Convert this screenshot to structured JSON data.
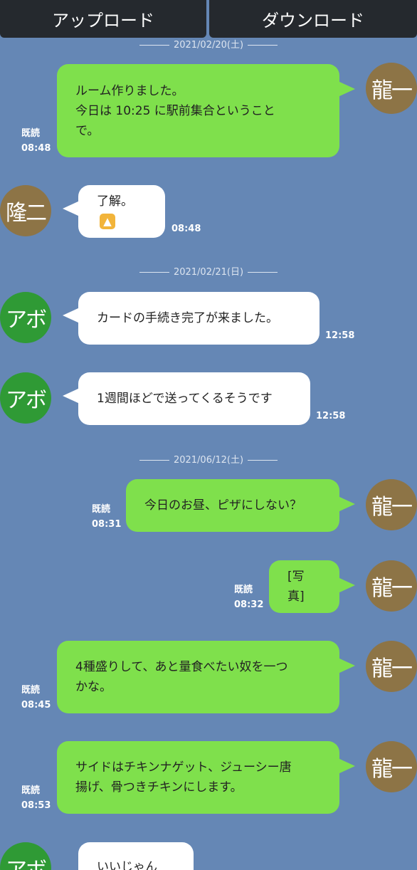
{
  "tabs": {
    "upload": "アップロード",
    "download": "ダウンロード"
  },
  "dates": [
    "2021/02/20(土)",
    "2021/02/21(日)",
    "2021/06/12(土)"
  ],
  "read_label": "既読",
  "avatars": {
    "ryuichi": "龍一",
    "ryuji": "隆二",
    "abo": "アボ"
  },
  "messages": [
    {
      "line1": "ルーム作りました。",
      "line2": "今日は 10:25 に駅前集合ということ",
      "line3": "で。",
      "time": "08:48"
    },
    {
      "text": "了解。",
      "emoji": "👍",
      "time": "08:48"
    },
    {
      "text": "カードの手続き完了が来ました。",
      "time": "12:58"
    },
    {
      "text": "1週間ほどで送ってくるそうです",
      "time": "12:58"
    },
    {
      "text": "今日のお昼、ピザにしない？",
      "time": "08:31"
    },
    {
      "text": "[写真]",
      "time": "08:32"
    },
    {
      "line1": "4種盛りして、あと量食べたい奴を一つ",
      "line2": "かな。",
      "time": "08:45"
    },
    {
      "line1": "サイドはチキンナゲット、ジューシー唐",
      "line2": "揚げ、骨つきチキンにします。",
      "time": "08:53"
    },
    {
      "text": "いいじゃん"
    }
  ]
}
